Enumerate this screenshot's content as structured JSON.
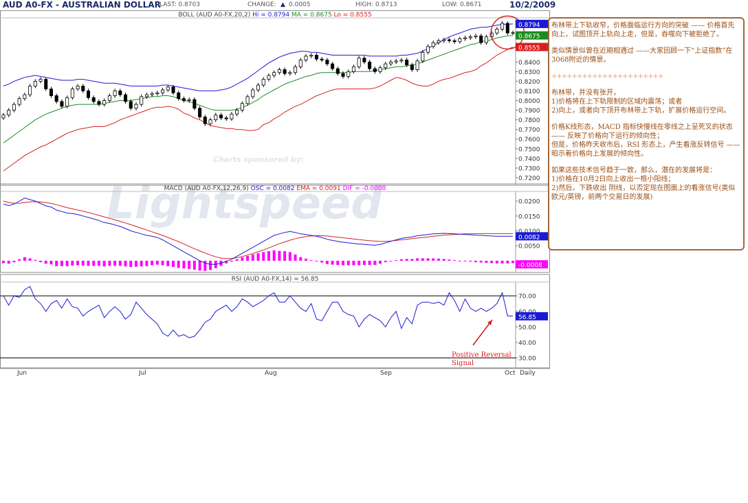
{
  "header": {
    "title": "AUD A0-FX - AUSTRALIAN DOLLAR",
    "last": "LAST: 0.8703",
    "change_label": "CHANGE:",
    "change_value": "0.0005",
    "high": "HIGH: 0.8713",
    "low": "LOW: 0.8671",
    "date": "10/2/2009"
  },
  "colors": {
    "upper_band": "#1a1ad6",
    "middle_band": "#1f8a1f",
    "lower_band": "#d62020",
    "macd_line": "#1a1ad6",
    "ema_line": "#d62020",
    "histogram": "#ff00ff",
    "rsi_line": "#1a1ad6",
    "annotation": "#d62020"
  },
  "watermark": {
    "sponsor": "Charts sponsored by:",
    "brand": "Lightspeed"
  },
  "chart_data": [
    {
      "type": "candlestick",
      "title": "BOLL (AUD A0-FX,20,2)",
      "legend": [
        {
          "label": "Hi = 0.8794",
          "color": "#1a1ad6"
        },
        {
          "label": "MA = 0.8675",
          "color": "#1f8a1f"
        },
        {
          "label": "Lo = 0.8555",
          "color": "#d62020"
        }
      ],
      "ylim": [
        0.715,
        0.885
      ],
      "yticks": [
        "0.8400",
        "0.8300",
        "0.8200",
        "0.8100",
        "0.8000",
        "0.7900",
        "0.7800",
        "0.7700",
        "0.7600",
        "0.7500",
        "0.7400",
        "0.7300",
        "0.7200"
      ],
      "value_tags": [
        {
          "text": "0.8794",
          "value": 0.8794,
          "color": "#1a1ad6"
        },
        {
          "text": "0.8675",
          "value": 0.8675,
          "color": "#1f8a1f"
        },
        {
          "text": "0.8555",
          "value": 0.8555,
          "color": "#d62020"
        }
      ],
      "close": [
        0.785,
        0.79,
        0.796,
        0.802,
        0.806,
        0.815,
        0.82,
        0.822,
        0.812,
        0.805,
        0.799,
        0.794,
        0.803,
        0.812,
        0.815,
        0.81,
        0.803,
        0.799,
        0.796,
        0.8,
        0.805,
        0.81,
        0.806,
        0.799,
        0.792,
        0.796,
        0.804,
        0.806,
        0.807,
        0.808,
        0.811,
        0.814,
        0.808,
        0.802,
        0.8,
        0.801,
        0.792,
        0.783,
        0.776,
        0.78,
        0.785,
        0.782,
        0.781,
        0.786,
        0.79,
        0.797,
        0.804,
        0.811,
        0.816,
        0.822,
        0.826,
        0.829,
        0.832,
        0.828,
        0.829,
        0.835,
        0.842,
        0.846,
        0.847,
        0.843,
        0.842,
        0.838,
        0.833,
        0.828,
        0.825,
        0.83,
        0.835,
        0.844,
        0.84,
        0.833,
        0.83,
        0.834,
        0.838,
        0.84,
        0.841,
        0.842,
        0.837,
        0.832,
        0.841,
        0.85,
        0.856,
        0.86,
        0.862,
        0.863,
        0.862,
        0.861,
        0.864,
        0.865,
        0.866,
        0.867,
        0.86,
        0.866,
        0.87,
        0.874,
        0.88,
        0.87,
        0.8703
      ],
      "bands": {
        "upper": [
          0.815,
          0.817,
          0.82,
          0.822,
          0.824,
          0.825,
          0.826,
          0.825,
          0.824,
          0.823,
          0.822,
          0.821,
          0.821,
          0.821,
          0.822,
          0.822,
          0.821,
          0.82,
          0.819,
          0.818,
          0.818,
          0.818,
          0.817,
          0.816,
          0.815,
          0.815,
          0.815,
          0.815,
          0.815,
          0.815,
          0.816,
          0.816,
          0.815,
          0.814,
          0.813,
          0.812,
          0.811,
          0.81,
          0.81,
          0.81,
          0.81,
          0.811,
          0.812,
          0.814,
          0.817,
          0.82,
          0.823,
          0.827,
          0.831,
          0.835,
          0.839,
          0.842,
          0.845,
          0.847,
          0.849,
          0.85,
          0.851,
          0.851,
          0.85,
          0.85,
          0.849,
          0.848,
          0.847,
          0.847,
          0.847,
          0.847,
          0.847,
          0.847,
          0.847,
          0.846,
          0.846,
          0.846,
          0.846,
          0.846,
          0.846,
          0.847,
          0.847,
          0.848,
          0.849,
          0.851,
          0.854,
          0.857,
          0.86,
          0.863,
          0.866,
          0.868,
          0.87,
          0.872,
          0.874,
          0.875,
          0.876,
          0.876,
          0.877,
          0.878,
          0.879,
          0.879,
          0.8794
        ],
        "middle": [
          0.756,
          0.76,
          0.764,
          0.768,
          0.772,
          0.776,
          0.78,
          0.783,
          0.786,
          0.788,
          0.79,
          0.792,
          0.794,
          0.795,
          0.796,
          0.796,
          0.796,
          0.796,
          0.796,
          0.797,
          0.798,
          0.799,
          0.8,
          0.8,
          0.8,
          0.801,
          0.802,
          0.803,
          0.804,
          0.804,
          0.805,
          0.805,
          0.804,
          0.802,
          0.8,
          0.799,
          0.797,
          0.795,
          0.793,
          0.791,
          0.79,
          0.79,
          0.79,
          0.79,
          0.791,
          0.793,
          0.795,
          0.798,
          0.801,
          0.805,
          0.808,
          0.811,
          0.814,
          0.817,
          0.819,
          0.821,
          0.823,
          0.825,
          0.826,
          0.828,
          0.829,
          0.829,
          0.829,
          0.829,
          0.829,
          0.829,
          0.83,
          0.83,
          0.83,
          0.83,
          0.831,
          0.832,
          0.833,
          0.834,
          0.835,
          0.835,
          0.836,
          0.837,
          0.838,
          0.84,
          0.842,
          0.844,
          0.846,
          0.848,
          0.85,
          0.852,
          0.854,
          0.856,
          0.858,
          0.859,
          0.861,
          0.862,
          0.863,
          0.865,
          0.866,
          0.867,
          0.8675
        ],
        "lower": [
          0.727,
          0.731,
          0.735,
          0.739,
          0.743,
          0.746,
          0.749,
          0.752,
          0.754,
          0.757,
          0.76,
          0.763,
          0.766,
          0.768,
          0.77,
          0.771,
          0.772,
          0.773,
          0.773,
          0.773,
          0.775,
          0.777,
          0.78,
          0.782,
          0.784,
          0.786,
          0.788,
          0.79,
          0.792,
          0.793,
          0.793,
          0.794,
          0.793,
          0.791,
          0.787,
          0.785,
          0.782,
          0.78,
          0.777,
          0.774,
          0.773,
          0.772,
          0.771,
          0.771,
          0.77,
          0.77,
          0.769,
          0.769,
          0.77,
          0.775,
          0.777,
          0.781,
          0.784,
          0.788,
          0.791,
          0.794,
          0.796,
          0.799,
          0.802,
          0.805,
          0.807,
          0.809,
          0.811,
          0.812,
          0.812,
          0.812,
          0.812,
          0.812,
          0.812,
          0.812,
          0.813,
          0.815,
          0.818,
          0.821,
          0.824,
          0.823,
          0.821,
          0.818,
          0.816,
          0.815,
          0.815,
          0.817,
          0.82,
          0.822,
          0.823,
          0.825,
          0.827,
          0.829,
          0.83,
          0.832,
          0.836,
          0.839,
          0.843,
          0.847,
          0.85,
          0.853,
          0.8555
        ]
      }
    },
    {
      "type": "line",
      "title": "MACD (AUD A0-FX,12,26,9)",
      "legend": [
        {
          "label": "OSC = 0.0082",
          "color": "#1a1ad6"
        },
        {
          "label": "EMA = 0.0091",
          "color": "#d62020"
        },
        {
          "label": "DIF = -0.0008",
          "color": "#ff00ff"
        }
      ],
      "ylim": [
        -0.003,
        0.023
      ],
      "yticks": [
        "0.0200",
        "0.0150",
        "0.0100",
        "0.0050"
      ],
      "value_tags": [
        {
          "text": "0.0082",
          "value": 0.0082,
          "color": "#1a1ad6"
        },
        {
          "text": "-0.0008",
          "value": -0.0012,
          "color": "#ff00ff"
        }
      ],
      "series": [
        {
          "name": "OSC",
          "values": [
            0.019,
            0.0185,
            0.019,
            0.02,
            0.021,
            0.0205,
            0.02,
            0.0192,
            0.0184,
            0.018,
            0.017,
            0.0165,
            0.016,
            0.0158,
            0.0155,
            0.015,
            0.0145,
            0.014,
            0.0135,
            0.0128,
            0.0125,
            0.012,
            0.0115,
            0.0108,
            0.01,
            0.0095,
            0.009,
            0.0085,
            0.0082,
            0.0078,
            0.007,
            0.006,
            0.005,
            0.004,
            0.003,
            0.002,
            0.001,
            0.0,
            -0.0008,
            -0.0012,
            -0.0012,
            -0.0008,
            -0.0002,
            0.0005,
            0.0015,
            0.0025,
            0.0035,
            0.0045,
            0.0055,
            0.0065,
            0.0075,
            0.0085,
            0.009,
            0.0095,
            0.0098,
            0.0095,
            0.009,
            0.0088,
            0.0085,
            0.0082,
            0.0078,
            0.0072,
            0.0068,
            0.0065,
            0.0062,
            0.006,
            0.0058,
            0.0056,
            0.0055,
            0.0053,
            0.0052,
            0.0055,
            0.006,
            0.0065,
            0.007,
            0.0075,
            0.0078,
            0.008,
            0.0084,
            0.0086,
            0.0088,
            0.009,
            0.0091,
            0.0092,
            0.0091,
            0.009,
            0.0089,
            0.0088,
            0.0087,
            0.0086,
            0.0085,
            0.0084,
            0.0083,
            0.0082,
            0.0082,
            0.0082,
            0.0082
          ]
        },
        {
          "name": "EMA",
          "values": [
            0.02,
            0.0195,
            0.0193,
            0.0193,
            0.0195,
            0.0197,
            0.0198,
            0.0197,
            0.0195,
            0.0192,
            0.0188,
            0.0183,
            0.0178,
            0.0174,
            0.017,
            0.0166,
            0.0162,
            0.0157,
            0.0152,
            0.0147,
            0.0142,
            0.0137,
            0.0132,
            0.0127,
            0.0121,
            0.0115,
            0.0109,
            0.0103,
            0.0097,
            0.0091,
            0.0085,
            0.0078,
            0.0071,
            0.0064,
            0.0056,
            0.0048,
            0.004,
            0.0033,
            0.0026,
            0.0019,
            0.0013,
            0.0009,
            0.0007,
            0.0008,
            0.001,
            0.0014,
            0.0019,
            0.0024,
            0.003,
            0.0036,
            0.0043,
            0.005,
            0.0057,
            0.0063,
            0.0069,
            0.0074,
            0.0078,
            0.0081,
            0.0083,
            0.0084,
            0.0084,
            0.0083,
            0.0081,
            0.0079,
            0.0077,
            0.0075,
            0.0073,
            0.0071,
            0.0069,
            0.0067,
            0.0066,
            0.0065,
            0.0065,
            0.0066,
            0.0068,
            0.007,
            0.0072,
            0.0074,
            0.0076,
            0.0078,
            0.008,
            0.0082,
            0.0084,
            0.0086,
            0.0087,
            0.0088,
            0.0089,
            0.009,
            0.009,
            0.0091,
            0.0091,
            0.0091,
            0.0091,
            0.0091,
            0.0091,
            0.0091,
            0.0091
          ]
        },
        {
          "name": "DIF",
          "values": [
            -0.0008,
            -0.001,
            -0.0005,
            0.0005,
            0.0012,
            0.0008,
            0.0003,
            -0.0005,
            -0.001,
            -0.0012,
            -0.0018,
            -0.0018,
            -0.0018,
            -0.0016,
            -0.0015,
            -0.0016,
            -0.0017,
            -0.0017,
            -0.0017,
            -0.0019,
            -0.0017,
            -0.0017,
            -0.0017,
            -0.0019,
            -0.0021,
            -0.002,
            -0.0019,
            -0.0018,
            -0.0015,
            -0.0013,
            -0.0015,
            -0.0018,
            -0.0021,
            -0.0024,
            -0.0026,
            -0.0028,
            -0.003,
            -0.0033,
            -0.0034,
            -0.0031,
            -0.0025,
            -0.0017,
            -0.0009,
            -0.0003,
            0.0005,
            0.0011,
            0.0016,
            0.0021,
            0.0025,
            0.0029,
            0.0032,
            0.0035,
            0.0033,
            0.0032,
            0.0029,
            0.0021,
            0.0012,
            0.0007,
            0.0002,
            -0.0002,
            -0.0006,
            -0.0011,
            -0.0013,
            -0.0014,
            -0.0015,
            -0.0015,
            -0.0015,
            -0.0015,
            -0.0014,
            -0.0014,
            -0.0014,
            -0.001,
            -0.0005,
            -0.0001,
            0.0002,
            0.0005,
            0.0006,
            0.0006,
            0.0008,
            0.0008,
            0.0008,
            0.0008,
            0.0007,
            0.0006,
            0.0004,
            0.0002,
            0.0,
            -0.0002,
            -0.0003,
            -0.0005,
            -0.0006,
            -0.0007,
            -0.0008,
            -0.0009,
            -0.0009,
            -0.0009,
            -0.0008
          ]
        }
      ]
    },
    {
      "type": "line",
      "title": "RSI (AUD A0-FX,14) = 56.85",
      "ylim": [
        25,
        78
      ],
      "yticks": [
        "70.00",
        "60.00",
        "50.00",
        "40.00",
        "30.00"
      ],
      "reference_lines": [
        70,
        30
      ],
      "value_tags": [
        {
          "text": "56.85",
          "value": 56.85,
          "color": "#1a1ad6"
        }
      ],
      "x_labels": [
        "Jun",
        "Jul",
        "Aug",
        "Sep",
        "Oct",
        "Daily"
      ],
      "series": [
        {
          "name": "RSI",
          "values": [
            70,
            64,
            70,
            69,
            74,
            76,
            68,
            65,
            60,
            65,
            67,
            62,
            68,
            63,
            62,
            57,
            60,
            62,
            64,
            56,
            60,
            63,
            60,
            55,
            58,
            66,
            62,
            58,
            55,
            52,
            46,
            44,
            48,
            44,
            45,
            43,
            44,
            48,
            53,
            55,
            60,
            62,
            64,
            60,
            63,
            68,
            66,
            63,
            65,
            67,
            70,
            72,
            66,
            66,
            70,
            66,
            62,
            60,
            65,
            55,
            54,
            60,
            66,
            66,
            60,
            58,
            57,
            50,
            55,
            58,
            56,
            54,
            50,
            56,
            60,
            49,
            56,
            52,
            64,
            66,
            66,
            65,
            66,
            64,
            72,
            67,
            60,
            68,
            62,
            60,
            62,
            60,
            62,
            65,
            72,
            57,
            57
          ]
        }
      ]
    }
  ],
  "annotation": {
    "text": "Positive Reversal Signal"
  },
  "note": {
    "paragraphs": [
      "布林带上下轨收窄，价格面临运行方向的突破 —— 价格首先向上，试图顶开上轨向上走，但是，吞噬向下被拒绝了。",
      "类似情景似曾在近期相遇过 ——大家回顾一下“上证指数”在3068附近的情景。",
      "++++++++++++++++++++++",
      "布林带，并没有张开，\n1)价格将在上下轨限制的区域内震荡；或者\n2)向上，或者向下顶开布林带上下轨，扩展价格运行空间。",
      "价格K线形态，MACD 指标快慢线在零线之上呈死叉的状态 —— 反映了价格向下运行的倾向性；\n但是，价格昨天收市后，RSI 形态上，产生看涨反转信号 —— 昭示着价格向上发展的倾向性。",
      "如果这些技术信号趋于一致，那么，潜在的发展将是：\n1)价格在10月2日向上收出一根小阳线；\n2)然后，下跌收出 阴线，以否定现在图面上的看涨信号(类似欧元/英镑，前两个交易日的发展)"
    ]
  }
}
